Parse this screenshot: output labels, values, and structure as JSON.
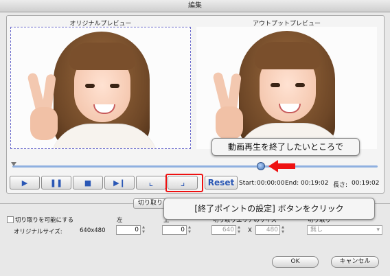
{
  "window": {
    "title": "編集"
  },
  "preview": {
    "original_label": "オリジナルプレビュー",
    "output_label": "アウトプットプレビュー"
  },
  "callouts": {
    "top": "動画再生を終了したいところで",
    "bottom": "[終了ポイントの設定] ボタンをクリック"
  },
  "controls": {
    "play_icon": "▶",
    "pause_icon": "❚❚",
    "stop_icon": "■",
    "next_icon": "▶❙",
    "start_icon": "⌞",
    "end_icon": "⌟",
    "reset_label": "Reset"
  },
  "time": {
    "start_label": "Start:",
    "start_value": "00:00:00",
    "end_label": "End:",
    "end_value": "00:19:02",
    "length_label": "長さ:",
    "length_value": "00:19:02"
  },
  "crop": {
    "tab_label": "切り取り",
    "enable_label": "切り取りを可能にする",
    "original_size_label": "オリジナルサイズ:",
    "original_size_value": "640x480",
    "left_label": "左",
    "top_label": "上",
    "area_size_label": "切り取りエリアのサイズ",
    "aspect_label": "切り取り",
    "left_value": "0",
    "top_value": "0",
    "width_value": "640",
    "x_sep": "X",
    "height_value": "480",
    "aspect_value": "無し"
  },
  "buttons": {
    "ok": "OK",
    "cancel": "キャンセル"
  },
  "colors": {
    "accent": "#2a57b5",
    "highlight": "#ee1111"
  }
}
